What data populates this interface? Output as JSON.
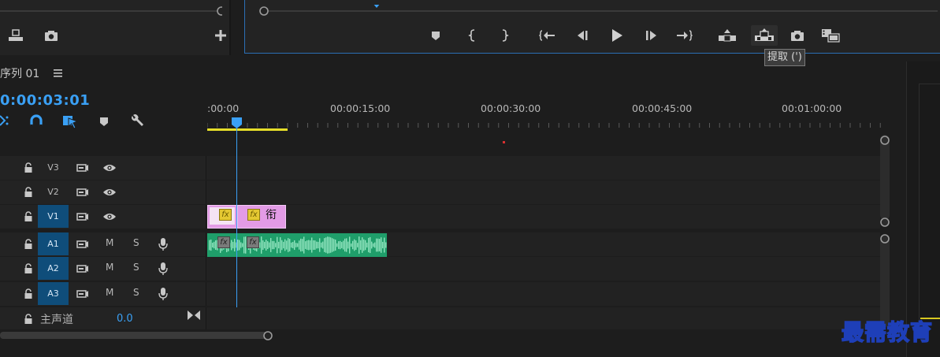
{
  "sequence": {
    "title": "序列 01",
    "menu_icon": "hamburger-icon"
  },
  "timecode": "0:00:03:01",
  "ruler": {
    "labels": [
      ":00:00",
      "00:00:15:00",
      "00:00:30:00",
      "00:00:45:00",
      "00:01:00:00"
    ]
  },
  "tooltip": {
    "text": "提取 (')"
  },
  "tracks": {
    "video": [
      {
        "name": "V3",
        "selected": false
      },
      {
        "name": "V2",
        "selected": false
      },
      {
        "name": "V1",
        "selected": true
      }
    ],
    "audio": [
      {
        "name": "A1",
        "mute": "M",
        "solo": "S",
        "selected": true
      },
      {
        "name": "A2",
        "mute": "M",
        "solo": "S",
        "selected": true
      },
      {
        "name": "A3",
        "mute": "M",
        "solo": "S",
        "selected": true
      }
    ],
    "master": {
      "label": "主声道",
      "value": "0.0"
    }
  },
  "clips": {
    "v1_second_label": "衔",
    "fx_label": "fx"
  },
  "colors": {
    "accent": "#3aa0f5",
    "video_clip": "#e39be6",
    "audio_clip": "#1f9e6a",
    "work_area": "#e6de29"
  },
  "watermark": "最需教育"
}
